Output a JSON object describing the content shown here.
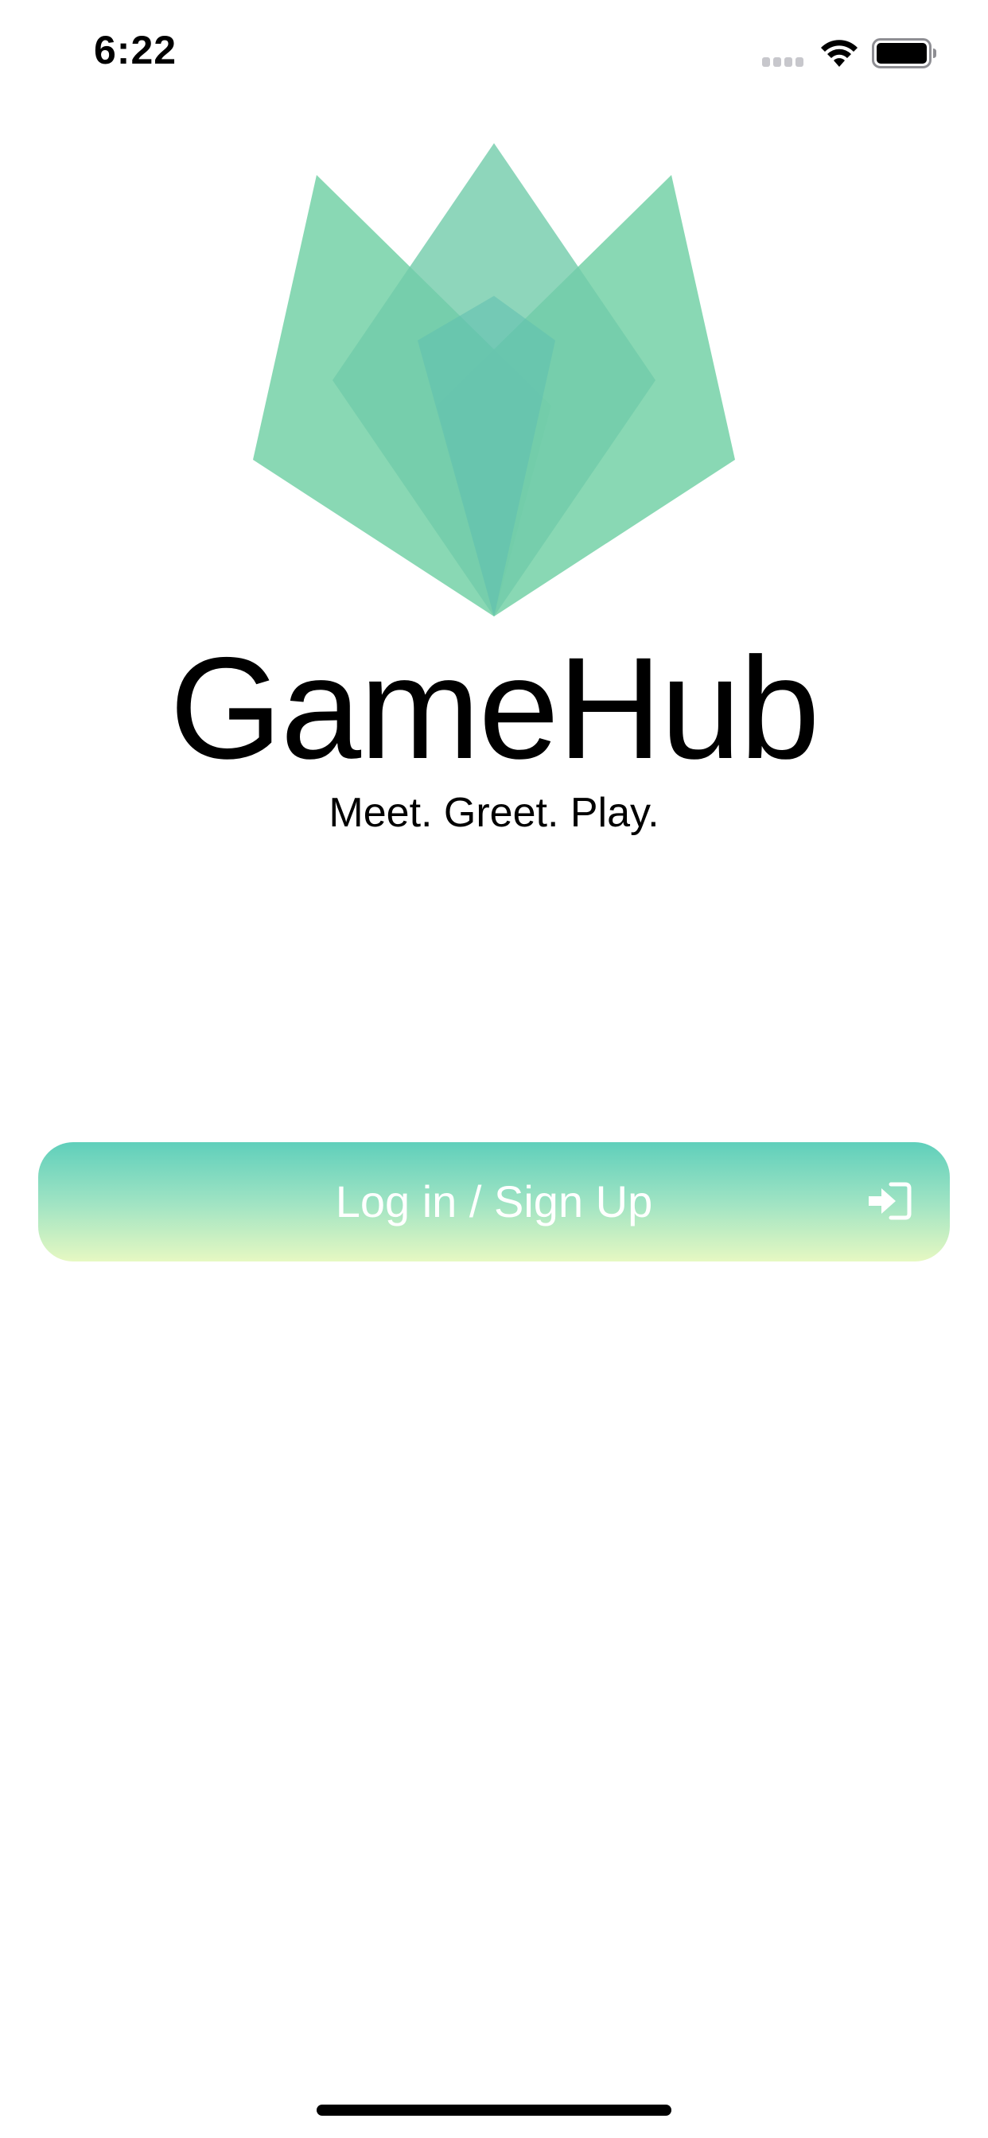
{
  "status_bar": {
    "time": "6:22"
  },
  "app": {
    "title": "GameHub",
    "tagline": "Meet. Greet. Play."
  },
  "login_button": {
    "label": "Log in / Sign Up",
    "icon": "sign-in-icon"
  },
  "colors": {
    "logo_green": "#7fd6ad",
    "button_top": "#5fcfbb",
    "button_bottom": "#e6f8c2",
    "button_text": "#ffffff"
  }
}
